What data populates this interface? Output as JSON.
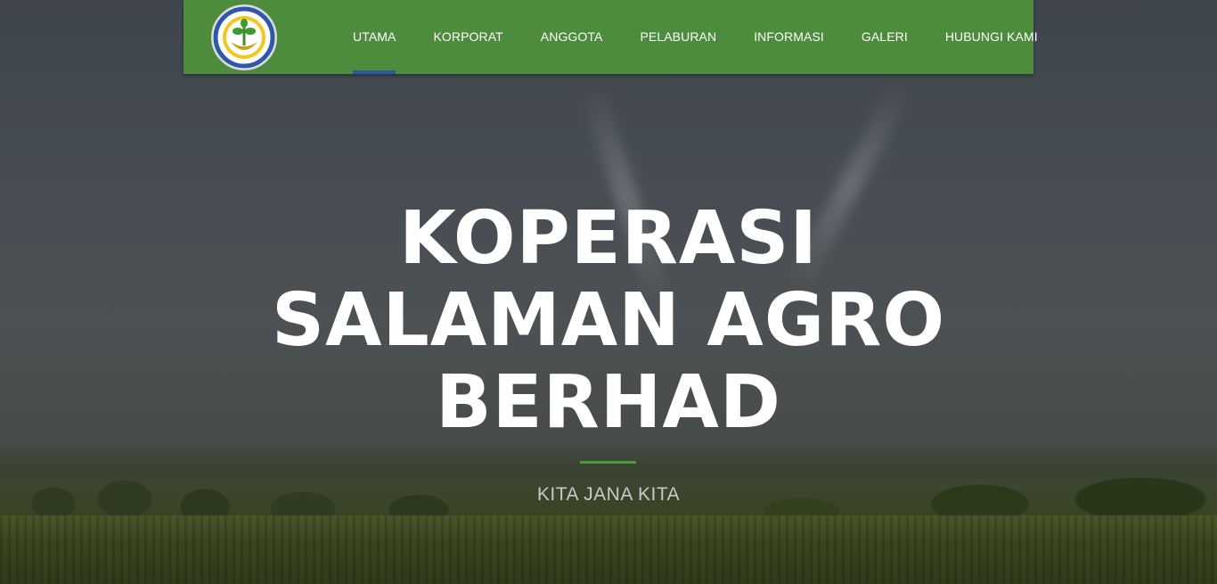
{
  "navbar": {
    "logo_alt": "Koperasi Salaman Agro Berhad logo",
    "items": [
      {
        "label": "UTAMA",
        "active": true
      },
      {
        "label": "KORPORAT"
      },
      {
        "label": "ANGGOTA"
      },
      {
        "label": "PELABURAN"
      },
      {
        "label": "INFORMASI"
      },
      {
        "label": "GALERI"
      },
      {
        "label": "HUBUNGI KAMI"
      }
    ]
  },
  "hero": {
    "title_line1": "KOPERASI",
    "title_line2": "SALAMAN AGRO",
    "title_line3": "BERHAD",
    "tagline": "KITA JANA KITA"
  },
  "colors": {
    "navbar_bg": "#4c8c3c",
    "active_indicator": "#2a5aa0",
    "divider": "#4c9a3e"
  }
}
